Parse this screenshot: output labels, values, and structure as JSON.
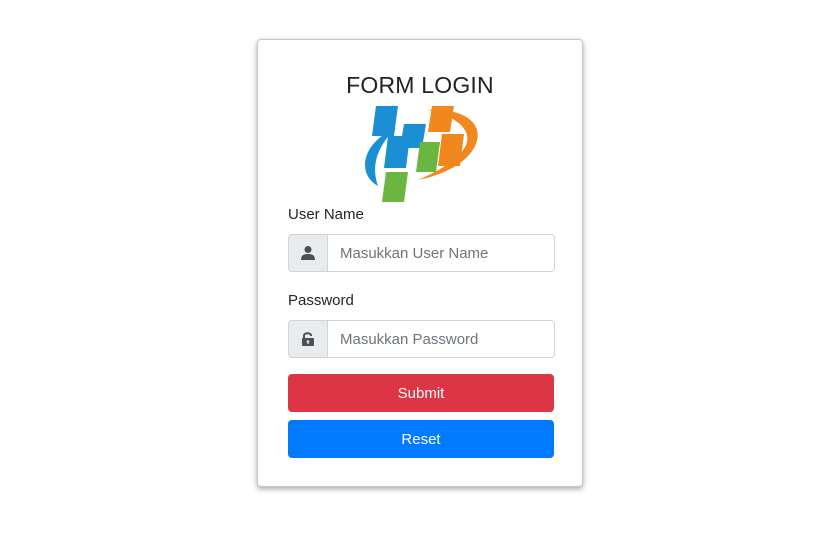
{
  "form": {
    "title": "FORM LOGIN",
    "username": {
      "label": "User Name",
      "placeholder": "Masukkan User Name",
      "value": "",
      "icon": "user-icon"
    },
    "password": {
      "label": "Password",
      "placeholder": "Masukkan Password",
      "value": "",
      "icon": "unlock-icon"
    },
    "submit_label": "Submit",
    "reset_label": "Reset"
  },
  "colors": {
    "submit": "#dc3545",
    "reset": "#007bff",
    "logo_blue": "#1b8fd4",
    "logo_orange": "#f0881d",
    "logo_green": "#6ab640",
    "icon": "#495057"
  }
}
